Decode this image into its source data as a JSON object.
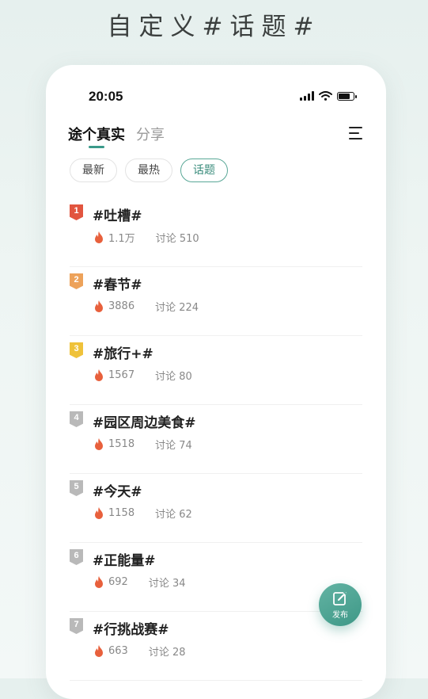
{
  "headline": "自定义#话题#",
  "status": {
    "time": "20:05",
    "battery_level": 0.8
  },
  "tabs": [
    {
      "label": "途个真实",
      "active": true
    },
    {
      "label": "分享",
      "active": false
    }
  ],
  "filters": [
    {
      "label": "最新",
      "active": false
    },
    {
      "label": "最热",
      "active": false
    },
    {
      "label": "话题",
      "active": true
    }
  ],
  "topics": [
    {
      "rank": "1",
      "title": "#吐槽#",
      "heat": "1.1万",
      "discuss": "讨论 510",
      "badge_color": "#e2553f"
    },
    {
      "rank": "2",
      "title": "#春节#",
      "heat": "3886",
      "discuss": "讨论 224",
      "badge_color": "#eda25a"
    },
    {
      "rank": "3",
      "title": "#旅行+#",
      "heat": "1567",
      "discuss": "讨论 80",
      "badge_color": "#efc23a"
    },
    {
      "rank": "4",
      "title": "#园区周边美食#",
      "heat": "1518",
      "discuss": "讨论 74",
      "badge_color": "#b9b9b9"
    },
    {
      "rank": "5",
      "title": "#今天#",
      "heat": "1158",
      "discuss": "讨论 62",
      "badge_color": "#b9b9b9"
    },
    {
      "rank": "6",
      "title": "#正能量#",
      "heat": "692",
      "discuss": "讨论 34",
      "badge_color": "#b9b9b9"
    },
    {
      "rank": "7",
      "title": "#行挑战赛#",
      "heat": "663",
      "discuss": "讨论 28",
      "badge_color": "#b9b9b9"
    }
  ],
  "fab": {
    "label": "发布",
    "icon": "edit-icon"
  },
  "colors": {
    "accent": "#3a9a8a",
    "flame": "#e8603c"
  }
}
